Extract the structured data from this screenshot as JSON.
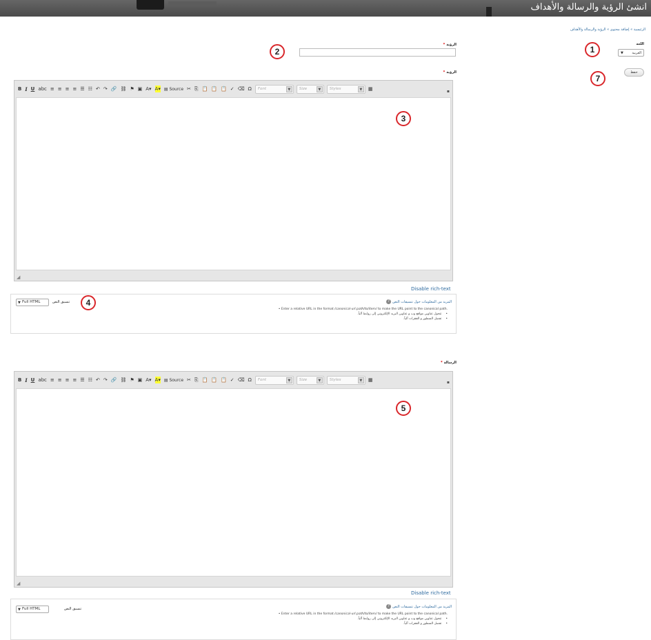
{
  "header": {
    "page_title": "انشئ الرؤية والرسالة والأهداف"
  },
  "breadcrumb": "الرئيسية » إضافة محتوى » الرؤية والرسالة والأهداف",
  "language": {
    "label": "اللغة",
    "selected": "العربية"
  },
  "save_label": "حفظ",
  "fields": {
    "vision_title_label": "الرؤية",
    "vision_body_label": "الرؤية",
    "mission_label": "الرسالة",
    "required_marker": "*"
  },
  "editor": {
    "source_label": "Source",
    "font_placeholder": "Font",
    "size_placeholder": "Size",
    "styles_placeholder": "Styles"
  },
  "disable_rich_text": "Disable rich-text",
  "text_format": {
    "label": "تنسيق النص",
    "selected": "Full HTML",
    "more_info": "المزيد من المعلومات حول تنسيقات النص",
    "tip_url_prefix": "Enter a relative URL in the format",
    "tip_url_path": "/canonical-url.path/to/item/",
    "tip_url_suffix": "to make the URL point to the canonical path.",
    "tip_links": "تتحول عناوين مواقع وب و عناوين البريد الإلكتروني إلى روابط آلياً.",
    "tip_lines": "تفصل السطور و الفقرات آلياً."
  },
  "callouts": [
    "1",
    "2",
    "3",
    "4",
    "5",
    "7"
  ]
}
